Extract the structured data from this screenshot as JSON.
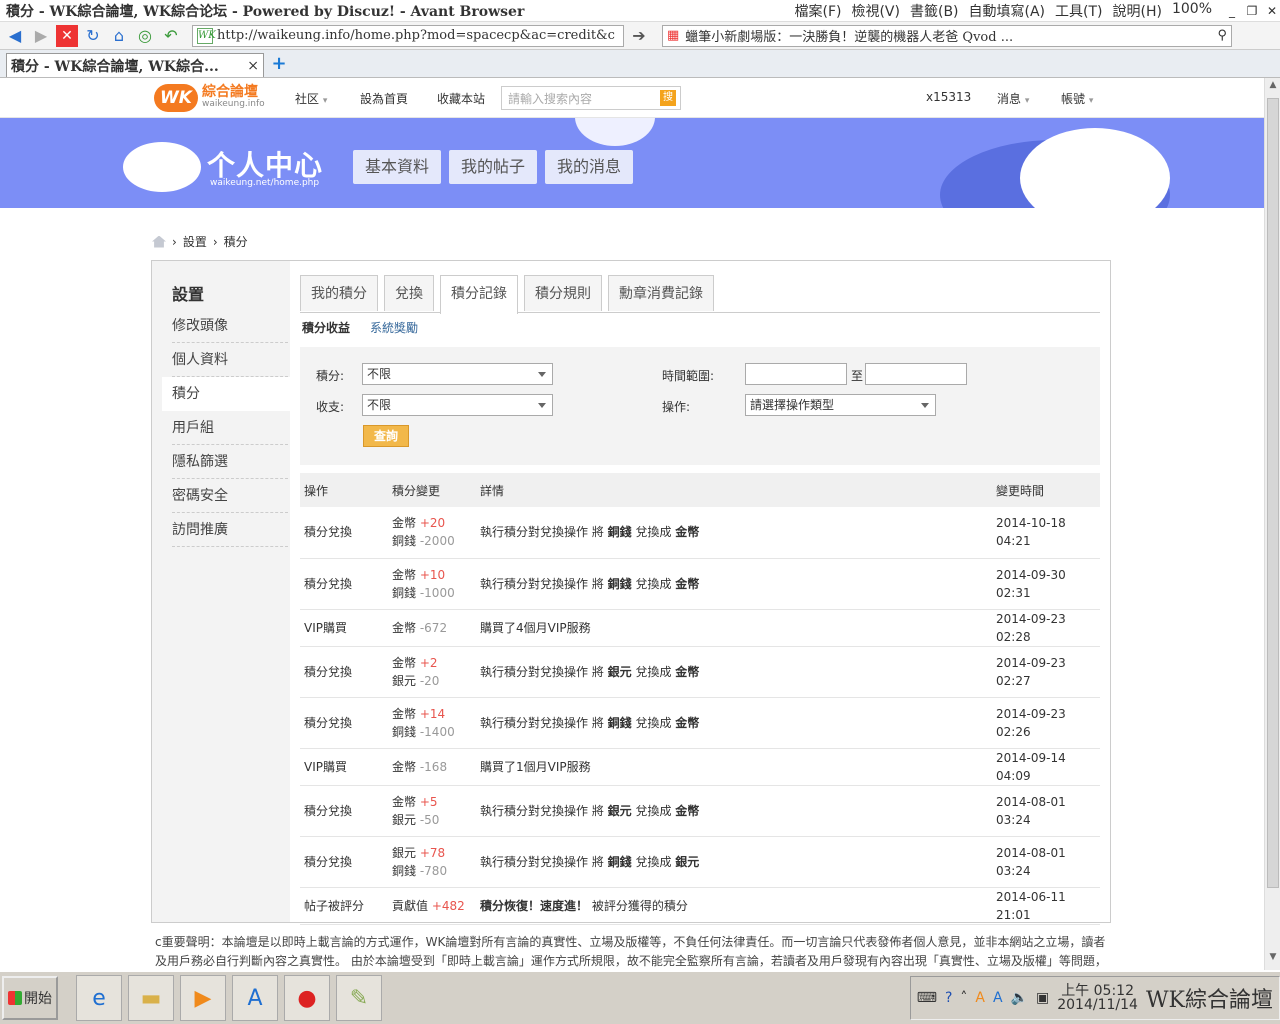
{
  "window": {
    "title": "積分 - WK綜合論壇, WK綜合论坛 - Powered by Discuz! - Avant Browser",
    "menu": [
      "檔案(F)",
      "檢視(V)",
      "書籤(B)",
      "自動填寫(A)",
      "工具(T)",
      "說明(H)",
      "100%"
    ]
  },
  "toolbar": {
    "address": "http://waikeung.info/home.php?mod=spacecp&ac=credit&c",
    "search_box": "蠟筆小新劇場版：一決勝負！逆襲的機器人老爸 Qvod ...",
    "favicon_text": "WK"
  },
  "tab": {
    "label": "積分 - WK綜合論壇, WK綜合...",
    "close": "×",
    "new": "+"
  },
  "site": {
    "logo_mark": "WK",
    "logo_name": "綜合論壇",
    "logo_domain": "waikeung.info",
    "nav": [
      "社区",
      "設為首頁",
      "收藏本站"
    ],
    "search_placeholder": "請輸入搜索內容",
    "search_button": "搜",
    "username": "x15313",
    "messages": "消息",
    "account": "帳號"
  },
  "banner": {
    "title": "个人中心",
    "url": "waikeung.net/home.php",
    "tabs": [
      "基本資料",
      "我的帖子",
      "我的消息"
    ]
  },
  "breadcrumb": [
    "設置",
    "積分"
  ],
  "sidebar": {
    "heading": "設置",
    "items": [
      "修改頭像",
      "個人資料",
      "積分",
      "用戶組",
      "隱私篩選",
      "密碼安全",
      "訪問推廣"
    ],
    "active_index": 2
  },
  "content_tabs": [
    "我的積分",
    "兌換",
    "積分記錄",
    "積分規則",
    "勳章消費記錄"
  ],
  "content_tab_active": 2,
  "sub_tabs": {
    "active": "積分收益",
    "other": "系統獎勵"
  },
  "filter": {
    "credit_label": "積分:",
    "credit_value": "不限",
    "io_label": "收支:",
    "io_value": "不限",
    "time_label": "時間範圍:",
    "time_to": "至",
    "op_label": "操作:",
    "op_value": "請選擇操作類型",
    "query_button": "查詢"
  },
  "table": {
    "headers": [
      "操作",
      "積分變更",
      "詳情",
      "變更時間"
    ],
    "rows": [
      {
        "op": "積分兌換",
        "c1n": "金幣",
        "c1v": "+20",
        "c2n": "銅錢",
        "c2v": "-2000",
        "d1": "執行積分對兌換操作 將 ",
        "db1": "銅錢",
        "d2": " 兌換成 ",
        "db2": "金幣",
        "d3": "",
        "time": "2014-10-18 04:21"
      },
      {
        "op": "積分兌換",
        "c1n": "金幣",
        "c1v": "+10",
        "c2n": "銅錢",
        "c2v": "-1000",
        "d1": "執行積分對兌換操作 將 ",
        "db1": "銅錢",
        "d2": " 兌換成 ",
        "db2": "金幣",
        "d3": "",
        "time": "2014-09-30 02:31"
      },
      {
        "op": "VIP購買",
        "c1n": "金幣",
        "c1v": "-672",
        "c2n": "",
        "c2v": "",
        "d1": "購買了4個月VIP服務",
        "db1": "",
        "d2": "",
        "db2": "",
        "d3": "",
        "time": "2014-09-23 02:28"
      },
      {
        "op": "積分兌換",
        "c1n": "金幣",
        "c1v": "+2",
        "c2n": "銀元",
        "c2v": "-20",
        "d1": "執行積分對兌換操作 將 ",
        "db1": "銀元",
        "d2": " 兌換成 ",
        "db2": "金幣",
        "d3": "",
        "time": "2014-09-23 02:27"
      },
      {
        "op": "積分兌換",
        "c1n": "金幣",
        "c1v": "+14",
        "c2n": "銅錢",
        "c2v": "-1400",
        "d1": "執行積分對兌換操作 將 ",
        "db1": "銅錢",
        "d2": " 兌換成 ",
        "db2": "金幣",
        "d3": "",
        "time": "2014-09-23 02:26"
      },
      {
        "op": "VIP購買",
        "c1n": "金幣",
        "c1v": "-168",
        "c2n": "",
        "c2v": "",
        "d1": "購買了1個月VIP服務",
        "db1": "",
        "d2": "",
        "db2": "",
        "d3": "",
        "time": "2014-09-14 04:09"
      },
      {
        "op": "積分兌換",
        "c1n": "金幣",
        "c1v": "+5",
        "c2n": "銀元",
        "c2v": "-50",
        "d1": "執行積分對兌換操作 將 ",
        "db1": "銀元",
        "d2": " 兌換成 ",
        "db2": "金幣",
        "d3": "",
        "time": "2014-08-01 03:24"
      },
      {
        "op": "積分兌換",
        "c1n": "銀元",
        "c1v": "+78",
        "c2n": "銅錢",
        "c2v": "-780",
        "d1": "執行積分對兌換操作 將 ",
        "db1": "銅錢",
        "d2": " 兌換成 ",
        "db2": "銀元",
        "d3": "",
        "time": "2014-08-01 03:24"
      },
      {
        "op": "帖子被評分",
        "c1n": "貢獻值",
        "c1v": "+482",
        "c2n": "",
        "c2v": "",
        "d1": "",
        "db1": "積分恢復！速度進！",
        "d2": "",
        "db2": "",
        "d3": " 被評分獲得的積分",
        "time": "2014-06-11 21:01"
      }
    ]
  },
  "footer": "c重要聲明：本論壇是以即時上載言論的方式運作，WK論壇對所有言論的真實性、立場及版權等，不負任何法律責任。而一切言論只代表發佈者個人意見，並非本網站之立場，讀者及用戶務必自行判斷內容之真實性。 由於本論壇受到「即時上載言論」運作方式所規限，故不能完全監察所有言論，若讀者及用戶發現有內容出現「真實性、立場及版權」等問題，",
  "taskbar": {
    "start": "開始",
    "clock_time": "上午 05:12",
    "clock_date": "2014/11/14",
    "active_app": "WK綜合論壇"
  },
  "colors": {
    "banner": "#7c8ef6",
    "accent": "#f47a20",
    "positive": "#e8554e",
    "query_button": "#f2b84a"
  }
}
